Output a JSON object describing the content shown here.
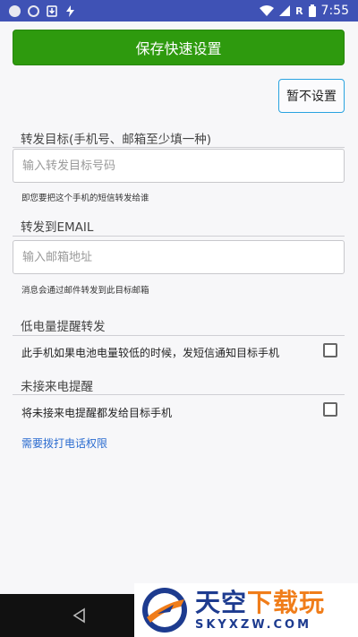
{
  "status_bar": {
    "time": "7:55",
    "network_label": "R",
    "icons": [
      "circle-icon",
      "circle-outline-icon",
      "download-icon",
      "bolt-icon",
      "wifi-icon",
      "signal-icon",
      "battery-icon"
    ]
  },
  "toolbar": {
    "save_label": "保存快速设置",
    "skip_label": "暂不设置"
  },
  "target_section": {
    "title": "转发目标(手机号、邮箱至少填一种)",
    "placeholder": "输入转发目标号码",
    "hint": "即您要把这个手机的短信转发给谁"
  },
  "email_section": {
    "title": "转发到EMAIL",
    "placeholder": "输入邮箱地址",
    "hint": "消息会通过邮件转发到此目标邮箱"
  },
  "low_battery_section": {
    "title": "低电量提醒转发",
    "option_label": "此手机如果电池电量较低的时候，发短信通知目标手机",
    "checked": false
  },
  "missed_call_section": {
    "title": "未接来电提醒",
    "option_label": "将未接来电提醒都发给目标手机",
    "checked": false
  },
  "permission_link": "需要拨打电话权限",
  "watermark": {
    "text_a": "天空",
    "text_b": "下载玩",
    "domain": "SKYXZW.COM"
  },
  "colors": {
    "status_bar": "#3f52b5",
    "primary_button": "#2e9a0e",
    "outline_button": "#29a3e0",
    "link": "#2b6cd0"
  }
}
